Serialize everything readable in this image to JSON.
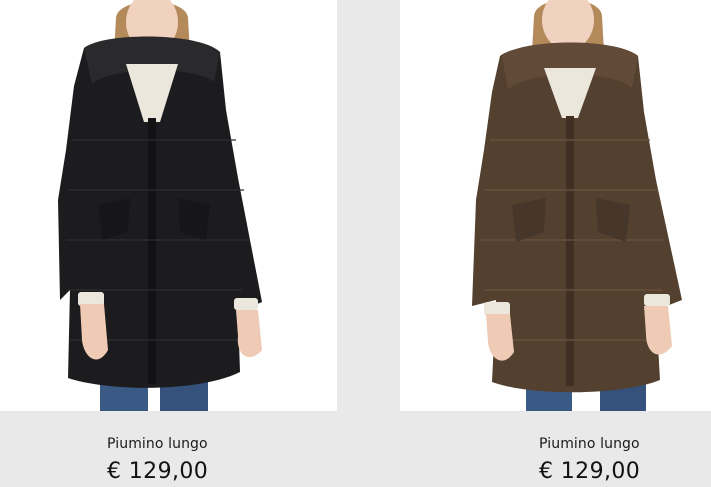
{
  "products": [
    {
      "name": "Piumino lungo",
      "price": "€ 129,00",
      "image": "model-in-black-long-down-jacket",
      "coat_color": "#1c1b1d"
    },
    {
      "name": "Piumino lungo",
      "price": "€ 129,00",
      "image": "model-in-brown-long-down-jacket",
      "coat_color": "#53402f"
    }
  ],
  "colors": {
    "page_background": "#e9e9e9",
    "photo_background": "#ffffff",
    "text": "#111111"
  }
}
